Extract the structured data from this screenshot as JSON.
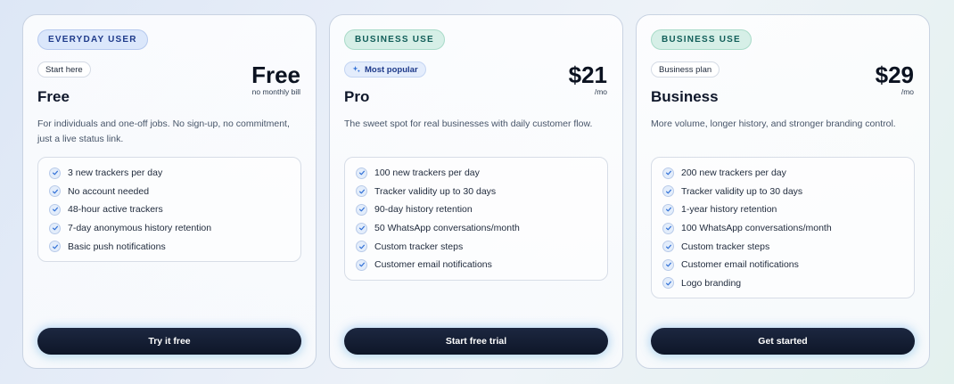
{
  "colors": {
    "accent_dark": "#0e1628",
    "tag_blue_bg": "#dbe7fb",
    "tag_green_bg": "#d6efe7",
    "check_color": "#2f6fd6"
  },
  "plans": [
    {
      "tag": "EVERYDAY USER",
      "pill": "Start here",
      "name": "Free",
      "price": "Free",
      "price_sub": "no monthly bill",
      "description": "For individuals and one-off jobs. No sign-up, no commitment, just a live status link.",
      "features": [
        "3 new trackers per day",
        "No account needed",
        "48-hour active trackers",
        "7-day anonymous history retention",
        "Basic push notifications"
      ],
      "cta": "Try it free"
    },
    {
      "tag": "BUSINESS USE",
      "pill": "Most popular",
      "pill_icon": "sparkle-icon",
      "name": "Pro",
      "price": "$21",
      "price_sub": "/mo",
      "description": "The sweet spot for real businesses with daily customer flow.",
      "features": [
        "100 new trackers per day",
        "Tracker validity up to 30 days",
        "90-day history retention",
        "50 WhatsApp conversations/month",
        "Custom tracker steps",
        "Customer email notifications"
      ],
      "cta": "Start free trial"
    },
    {
      "tag": "BUSINESS USE",
      "pill": "Business plan",
      "name": "Business",
      "price": "$29",
      "price_sub": "/mo",
      "description": "More volume, longer history, and stronger branding control.",
      "features": [
        "200 new trackers per day",
        "Tracker validity up to 30 days",
        "1-year history retention",
        "100 WhatsApp conversations/month",
        "Custom tracker steps",
        "Customer email notifications",
        "Logo branding"
      ],
      "cta": "Get started"
    }
  ]
}
